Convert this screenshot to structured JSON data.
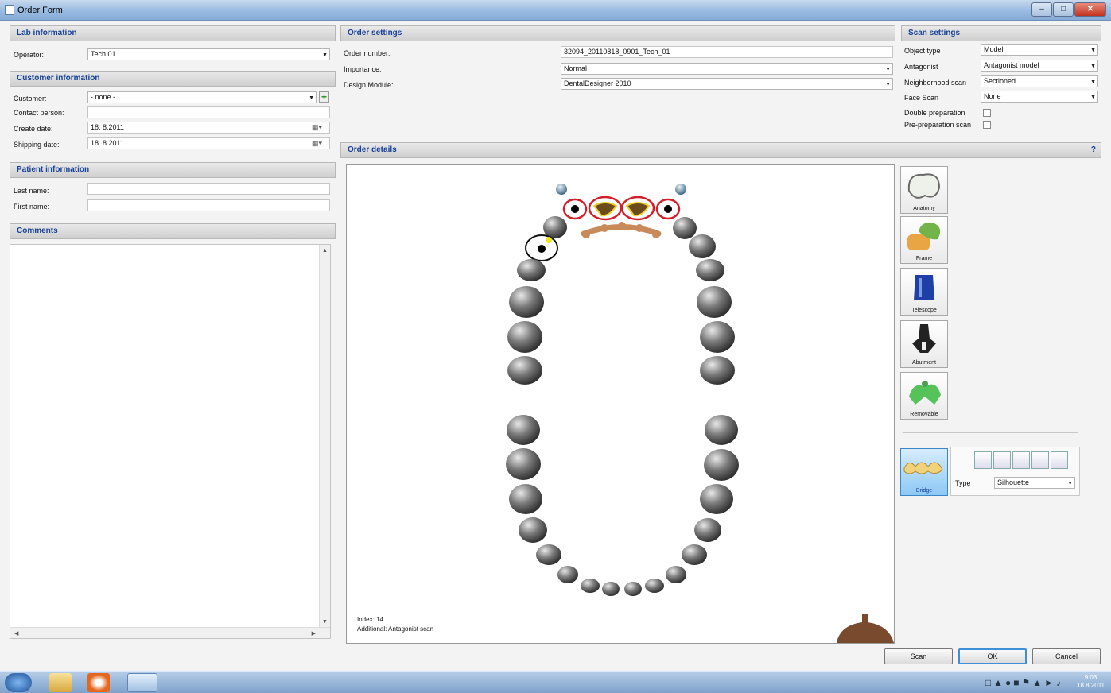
{
  "window": {
    "title": "Order Form"
  },
  "lab": {
    "heading": "Lab information",
    "operator_label": "Operator:",
    "operator_value": "Tech 01"
  },
  "customer": {
    "heading": "Customer information",
    "customer_label": "Customer:",
    "customer_value": "- none -",
    "contact_label": "Contact person:",
    "contact_value": "",
    "create_label": "Create date:",
    "create_value": "18. 8.2011",
    "shipping_label": "Shipping date:",
    "shipping_value": "18. 8.2011"
  },
  "patient": {
    "heading": "Patient information",
    "last_label": "Last name:",
    "last_value": "",
    "first_label": "First name:",
    "first_value": ""
  },
  "comments": {
    "heading": "Comments"
  },
  "order_settings": {
    "heading": "Order settings",
    "order_number_label": "Order number:",
    "order_number_value": "32094_20110818_0901_Tech_01",
    "importance_label": "Importance:",
    "importance_value": "Normal",
    "design_label": "Design Module:",
    "design_value": "DentalDesigner 2010"
  },
  "scan_settings": {
    "heading": "Scan settings",
    "object_label": "Object type",
    "object_value": "Model",
    "antagonist_label": "Antagonist",
    "antagonist_value": "Antagonist model",
    "neighborhood_label": "Neighborhood scan",
    "neighborhood_value": "Sectioned",
    "face_label": "Face Scan",
    "face_value": "None",
    "double_label": "Double preparation",
    "pre_label": "Pre-preparation scan"
  },
  "order_details": {
    "heading": "Order details",
    "help": "?",
    "index_text": "Index: 14",
    "additional_text": "Additional: Antagonist scan"
  },
  "tools": [
    {
      "label": "Anatomy"
    },
    {
      "label": "Frame"
    },
    {
      "label": "Telescope"
    },
    {
      "label": "Abutment"
    },
    {
      "label": "Removable"
    }
  ],
  "bridge": {
    "label": "Bridge",
    "type_label": "Type",
    "type_value": "Silhouette"
  },
  "buttons": {
    "scan": "Scan",
    "ok": "OK",
    "cancel": "Cancel"
  },
  "taskbar": {
    "time": "9:03",
    "date": "18.8.2011"
  },
  "colors": {
    "heading_text": "#17409a",
    "selection_ring": "#d21f2a",
    "pontic": "#c98a5b"
  }
}
